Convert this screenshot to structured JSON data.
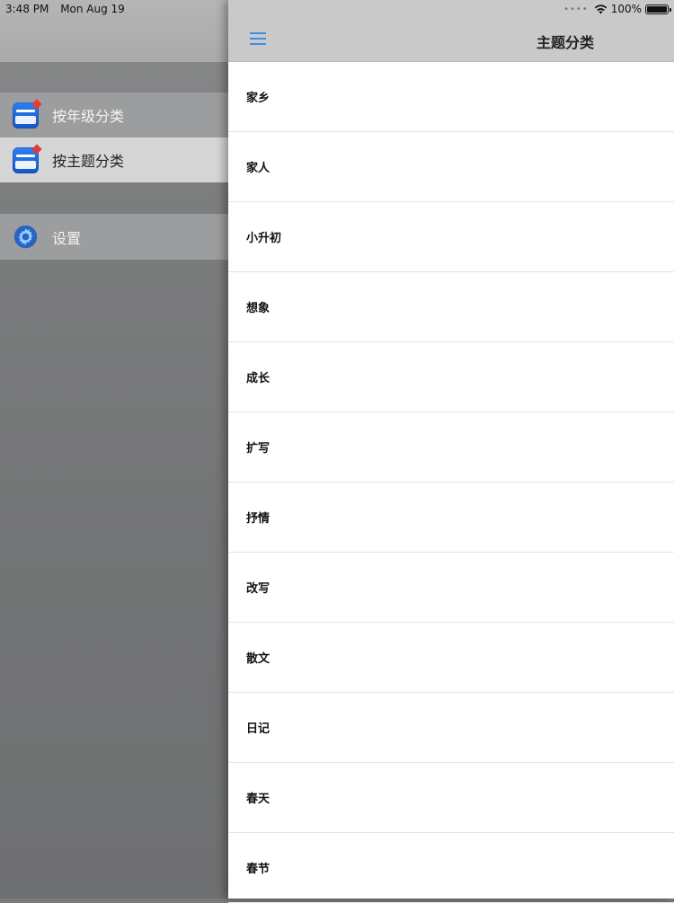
{
  "status_bar": {
    "time": "3:48 PM",
    "date": "Mon Aug 19",
    "battery": "100%",
    "battery_level": 1.0
  },
  "drawer": {
    "items": [
      {
        "label": "按年级分类",
        "icon": "app-book-icon",
        "selected": false
      },
      {
        "label": "按主题分类",
        "icon": "app-book-icon",
        "selected": true
      },
      {
        "label": "设置",
        "icon": "gear-icon",
        "selected": false
      }
    ]
  },
  "nav": {
    "title": "主题分类",
    "menu_icon": "hamburger-menu-icon",
    "accent": "#3d8fe0"
  },
  "topics": [
    "家乡",
    "家人",
    "小升初",
    "想象",
    "成长",
    "扩写",
    "抒情",
    "改写",
    "散文",
    "日记",
    "春天",
    "春节"
  ]
}
